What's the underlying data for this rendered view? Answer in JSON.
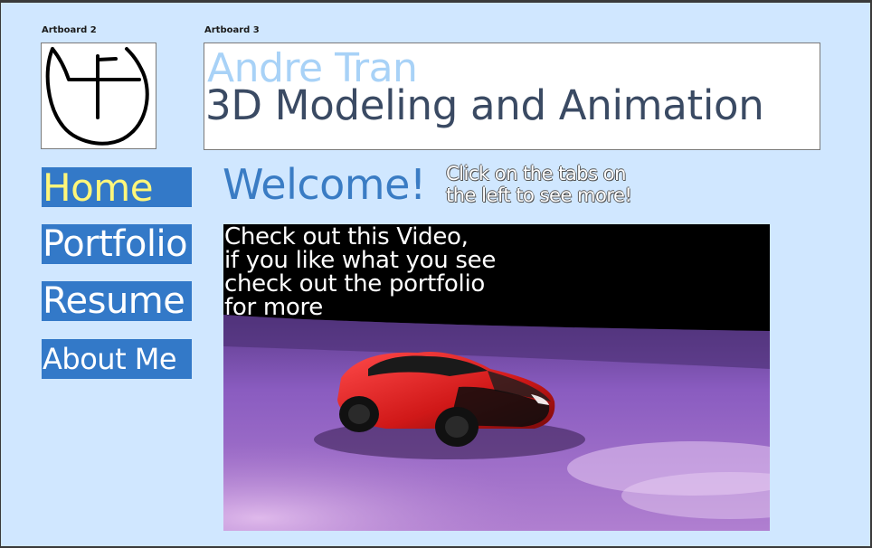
{
  "artboards": {
    "left_label": "Artboard 2",
    "right_label": "Artboard 3"
  },
  "logo": {
    "icon": "af-monogram-logo"
  },
  "header": {
    "name": "Andre Tran",
    "subtitle": "3D Modeling and Animation"
  },
  "nav": {
    "items": [
      {
        "label": "Home",
        "active": true
      },
      {
        "label": "Portfolio",
        "active": false
      },
      {
        "label": "Resume",
        "active": false
      },
      {
        "label": "About Me",
        "active": false
      }
    ]
  },
  "main": {
    "welcome": "Welcome!",
    "hint_line1": "Click on the tabs on",
    "hint_line2": "the left to see more!",
    "video": {
      "line1": "Check out this Video,",
      "line2": "if you like what you see",
      "line3": "check out the portfolio",
      "line4": "for more",
      "scene": "red-car-render"
    }
  },
  "colors": {
    "canvas": "#d0e7ff",
    "nav_bg": "#3379c8",
    "nav_active_text": "#fff67a",
    "name": "#a8d2f7",
    "subtitle": "#3a4a63",
    "welcome": "#3a7cc4"
  }
}
